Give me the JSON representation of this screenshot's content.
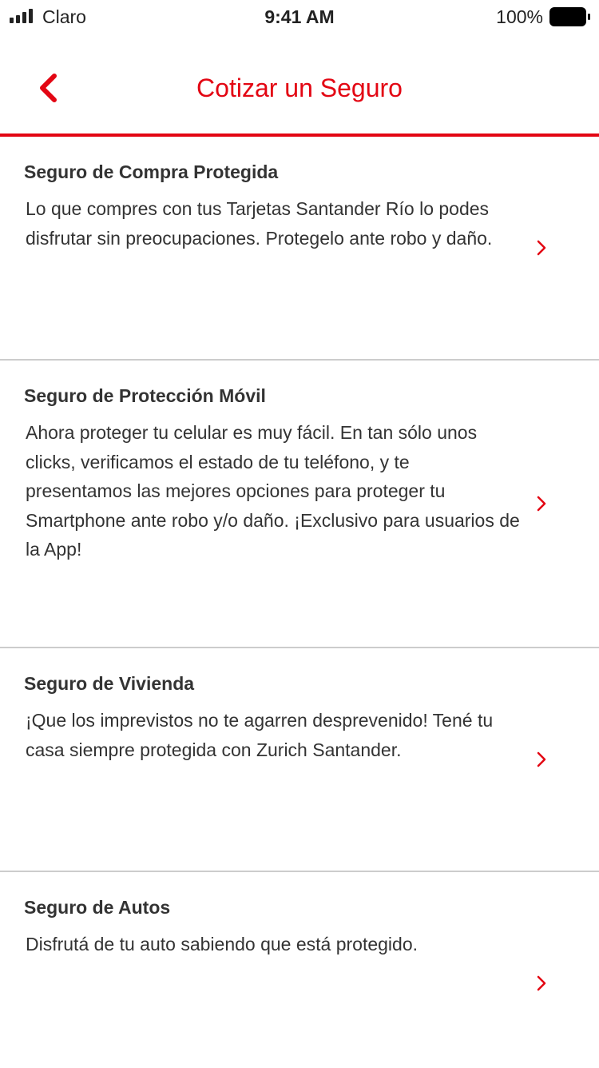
{
  "status_bar": {
    "carrier": "Claro",
    "time": "9:41 AM",
    "battery_percent": "100%"
  },
  "nav": {
    "title": "Cotizar un Seguro",
    "back_icon": "chevron-left-icon"
  },
  "colors": {
    "accent": "#e30613",
    "text": "#333333",
    "divider": "#cccccc"
  },
  "items": [
    {
      "title": "Seguro de Compra Protegida",
      "description": "Lo que compres con tus Tarjetas Santander Río lo podes disfrutar sin preocupaciones. Protegelo ante robo y daño.",
      "icon": "chevron-right-icon"
    },
    {
      "title": "Seguro de Protección Móvil",
      "description": "Ahora proteger tu celular es muy fácil. En tan sólo unos clicks, verificamos el estado de tu teléfono, y te presentamos las mejores opciones para proteger tu Smartphone ante robo y/o daño. ¡Exclusivo para usuarios de la App!",
      "icon": "chevron-right-icon"
    },
    {
      "title": "Seguro de Vivienda",
      "description": "¡Que los imprevistos no te agarren desprevenido! Tené tu casa siempre protegida con Zurich Santander.",
      "icon": "chevron-right-icon"
    },
    {
      "title": "Seguro de Autos",
      "description": "Disfrutá de tu auto sabiendo que está protegido.",
      "icon": "chevron-right-icon"
    }
  ]
}
